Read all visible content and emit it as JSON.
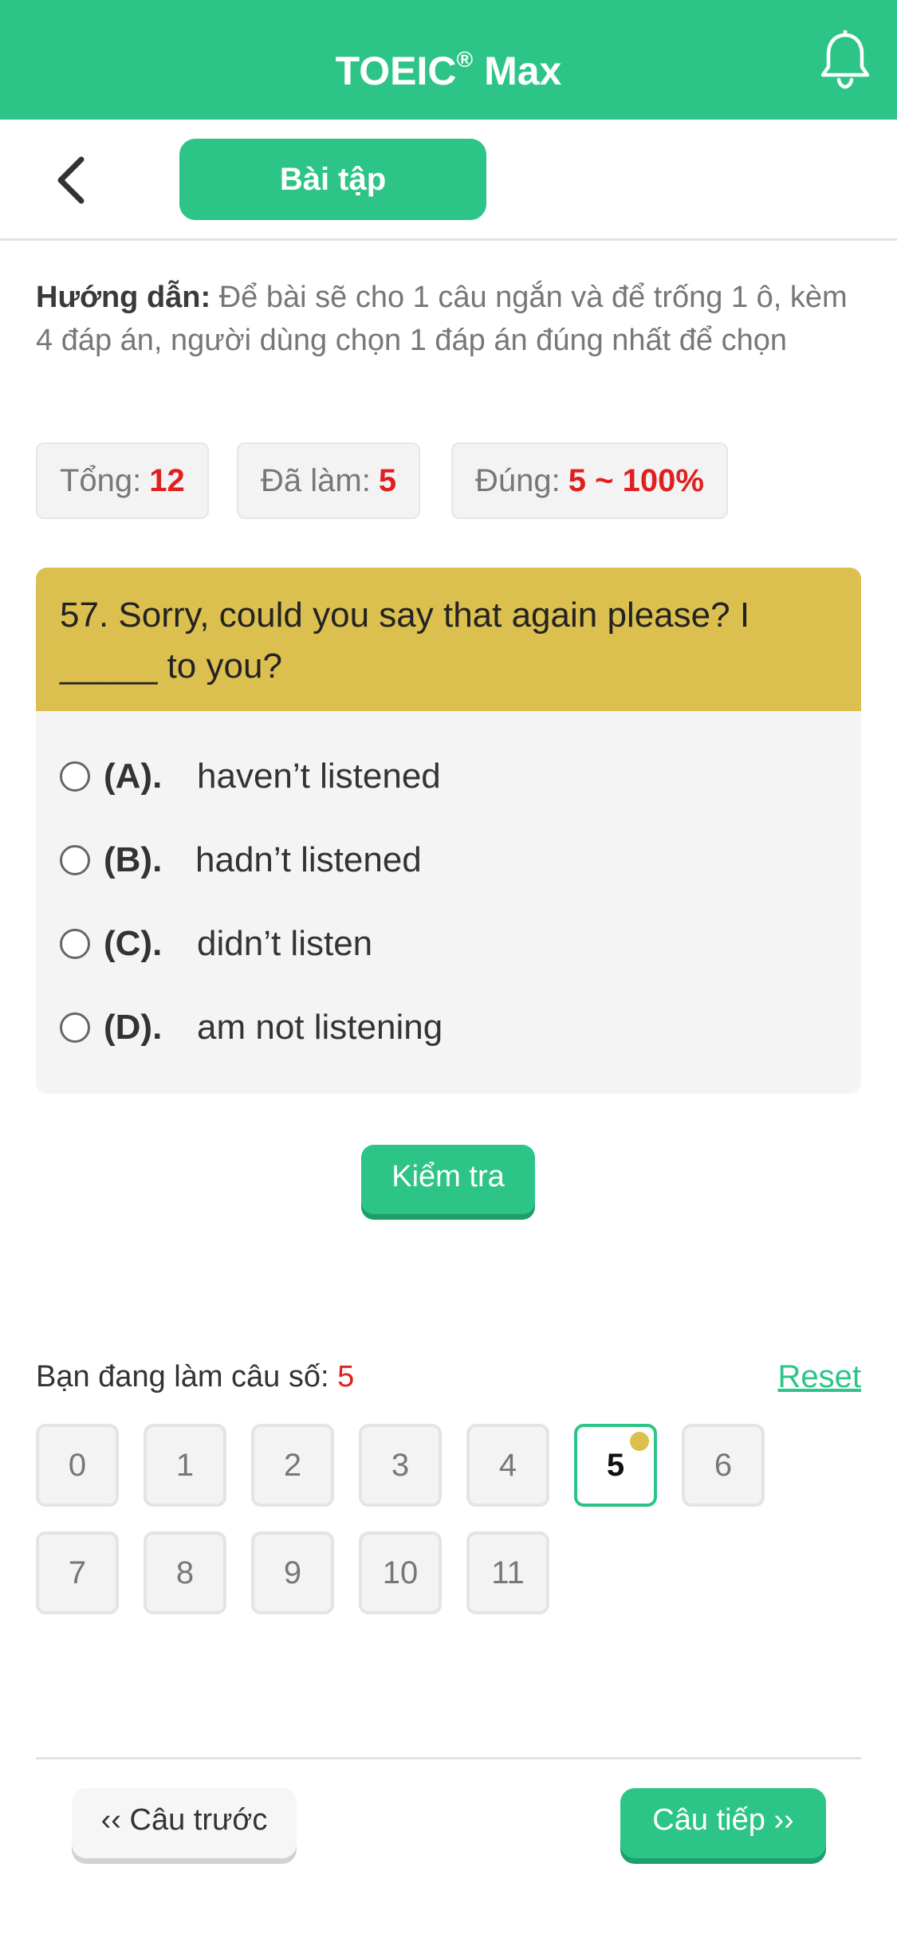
{
  "app": {
    "title_main": "TOEIC",
    "title_reg": "®",
    "title_suffix": " Max"
  },
  "subbar": {
    "tab_label": "Bài tập"
  },
  "guide": {
    "label": "Hướng dẫn:",
    "text": " Để bài sẽ cho 1 câu ngắn và để trống 1 ô, kèm 4 đáp án, người dùng chọn 1 đáp án đúng nhất để chọn"
  },
  "stats": {
    "total_label": "Tổng:",
    "total_value": "12",
    "done_label": "Đã làm:",
    "done_value": "5",
    "correct_label": "Đúng:",
    "correct_value": "5 ~ 100%"
  },
  "question": {
    "text": "57. Sorry, could you say that again please? I _____ to you?",
    "options": [
      {
        "key": "(A).",
        "text": "haven’t listened"
      },
      {
        "key": "(B).",
        "text": "hadn’t listened"
      },
      {
        "key": "(C).",
        "text": "didn’t listen"
      },
      {
        "key": "(D).",
        "text": "am not listening"
      }
    ]
  },
  "actions": {
    "check_label": "Kiểm tra",
    "prev_label": "‹‹ Câu trước",
    "next_label": "Câu tiếp ››",
    "reset_label": "Reset"
  },
  "progress": {
    "label": "Bạn đang làm câu số: ",
    "current": "5"
  },
  "question_numbers": [
    "0",
    "1",
    "2",
    "3",
    "4",
    "5",
    "6",
    "7",
    "8",
    "9",
    "10",
    "11"
  ],
  "colors": {
    "primary": "#2dc487",
    "question_header": "#dbbf4f",
    "accent_red": "#e02020"
  },
  "icons": {
    "notification": "bell-icon",
    "back": "chevron-left-icon"
  }
}
